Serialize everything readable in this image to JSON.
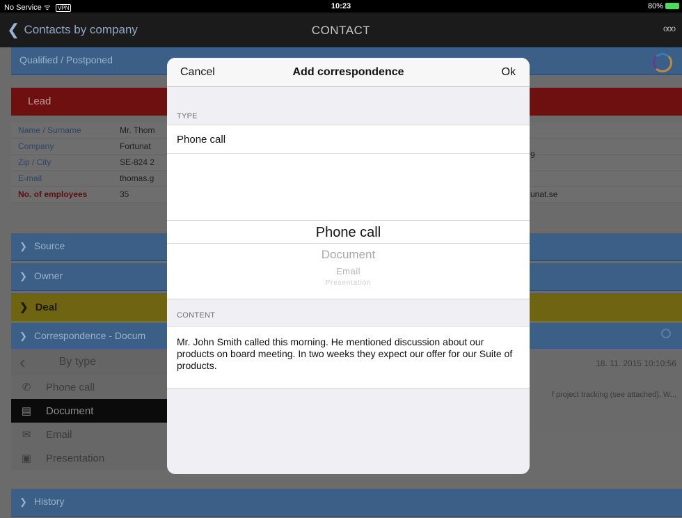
{
  "status": {
    "carrier": "No Service",
    "wifi": "wifi",
    "vpn": "VPN",
    "time": "10:23",
    "battery": "80%"
  },
  "nav": {
    "back_label": "Contacts by company",
    "title": "CONTACT",
    "more": "ooo"
  },
  "background": {
    "status_header": "Qualified / Postponed",
    "lead_label": "Lead",
    "fields": [
      {
        "key": "Name / Surname",
        "value": "Mr. Thom"
      },
      {
        "key": "Company",
        "value": "Fortunat"
      },
      {
        "key": "Zip / City",
        "value": "SE-824 2"
      },
      {
        "key": "E-mail",
        "value": "thomas.g"
      },
      {
        "key": "No. of employees",
        "value": "35"
      }
    ],
    "right_fragments": {
      "company": "9",
      "email": "unat.se"
    },
    "sections": {
      "source": "Source",
      "owner": "Owner",
      "deal": "Deal",
      "correspondence": "Correspondence - Docum",
      "history": "History"
    },
    "by_type": "By type",
    "types": [
      "Phone call",
      "Document",
      "Email",
      "Presentation"
    ],
    "selected_type": "Document",
    "entry_date": "18. 11. 2015 10:10:56",
    "entry_snippet": "f project tracking (see attached). W..."
  },
  "modal": {
    "cancel": "Cancel",
    "title": "Add correspondence",
    "ok": "Ok",
    "type_section": "TYPE",
    "type_value": "Phone call",
    "picker_options": [
      "Phone call",
      "Document",
      "Email",
      "Presentation"
    ],
    "content_section": "CONTENT",
    "content_text": "Mr. John Smith called this morning. He mentioned discussion about our products on board meeting. In two weeks they expect our offer for our Suite of products."
  }
}
